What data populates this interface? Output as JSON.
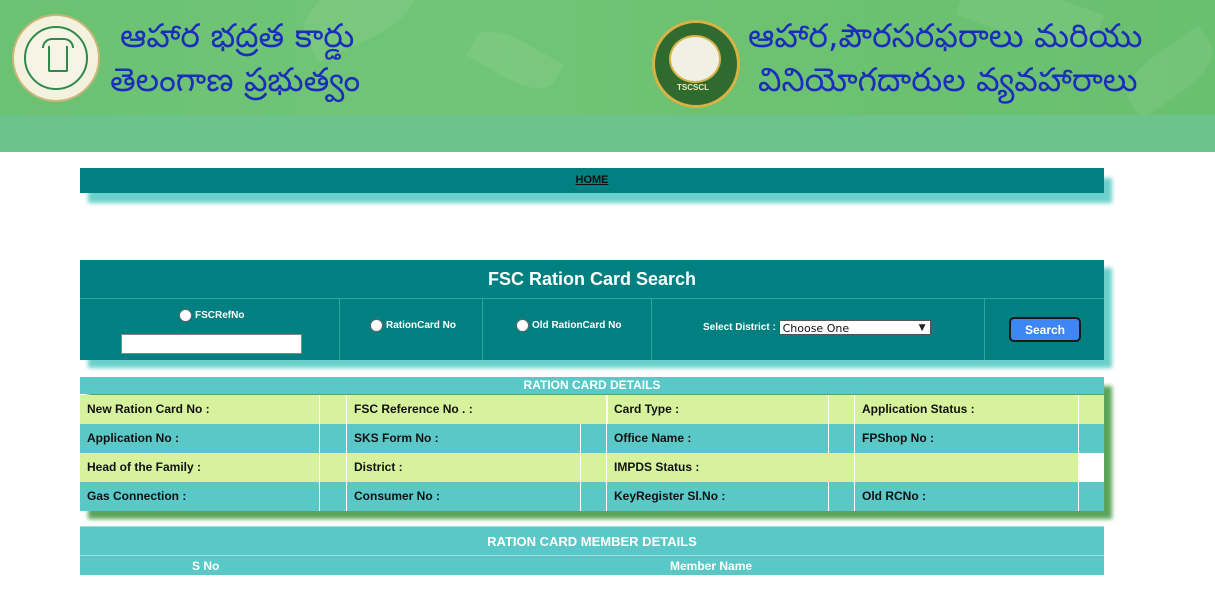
{
  "header": {
    "left_title_line1": "ఆహార భద్రత కార్డు",
    "left_title_line2": "తెలంగాణ ప్రభుత్వం",
    "right_title_line1": "ఆహార,పౌరసరఫరాలు మరియు",
    "right_title_line2": "వినియోగదారుల వ్యవహారాలు",
    "right_logo_text": "TSCSCL"
  },
  "nav": {
    "home_label": "HOME"
  },
  "search": {
    "title": "FSC Ration Card Search",
    "fscrefno_label": "FSCRefNo",
    "fscrefno_value": "",
    "rationcard_label": "RationCard No",
    "old_rationcard_label": "Old RationCard No",
    "district_label": "Select District :",
    "district_selected": "Choose One",
    "search_button": "Search"
  },
  "details": {
    "title": "RATION CARD DETAILS",
    "rows": [
      [
        "New Ration Card No :",
        "FSC Reference No . :",
        "Card Type :",
        "Application Status :"
      ],
      [
        "Application No :",
        "SKS Form No :",
        "Office Name :",
        "FPShop No :"
      ],
      [
        "Head of the Family :",
        "District :",
        "IMPDS Status :",
        ""
      ],
      [
        "Gas Connection :",
        "Consumer No :",
        "KeyRegister Sl.No :",
        "Old RCNo :"
      ]
    ]
  },
  "members": {
    "title": "RATION CARD MEMBER DETAILS",
    "col_sno": "S No",
    "col_name": "Member Name"
  },
  "colors": {
    "banner_green": "#6cc271",
    "teal": "#008080",
    "light_teal": "#5bc8c8",
    "light_green_row": "#d7f29c",
    "title_blue": "#1b2dba",
    "button_blue": "#3d86f3"
  }
}
